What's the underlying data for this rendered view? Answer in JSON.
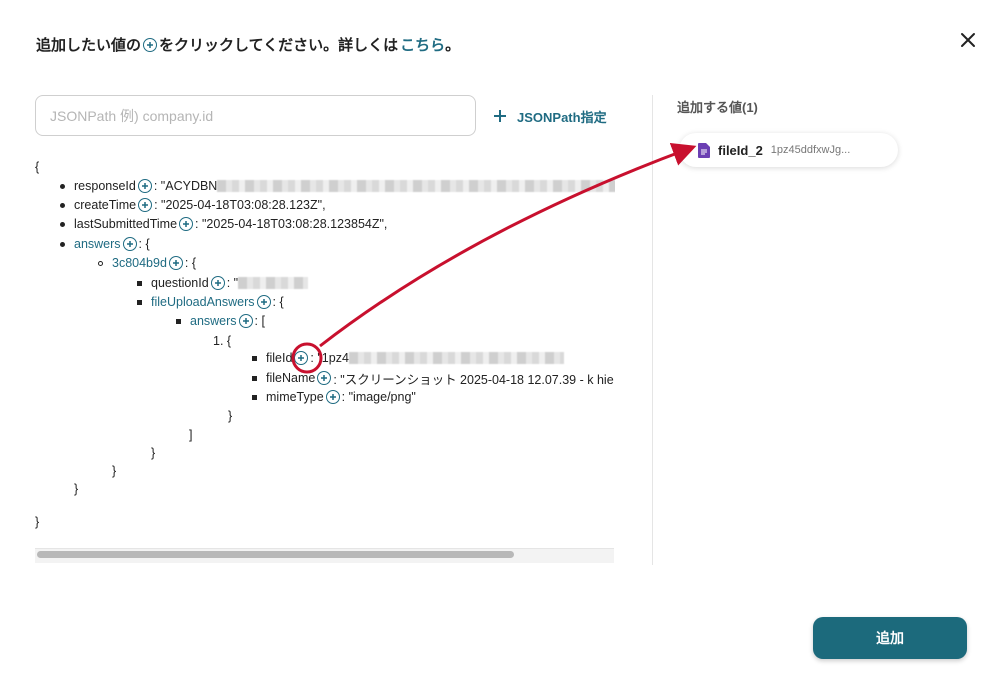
{
  "header": {
    "text_before": "追加したい値の",
    "text_after": "をクリックしてください。詳しくは",
    "link": "こちら",
    "end": "。"
  },
  "search": {
    "placeholder": "JSONPath 例) company.id",
    "value": ""
  },
  "jsonpath_button": {
    "label": "JSONPath指定"
  },
  "tree": {
    "open_brace": "{",
    "responseId": {
      "key": "responseId",
      "value": ": \"ACYDBN"
    },
    "createTime": {
      "key": "createTime",
      "value": ": \"2025-04-18T03:08:28.123Z\","
    },
    "lastSubmittedTime": {
      "key": "lastSubmittedTime",
      "value": ": \"2025-04-18T03:08:28.123854Z\","
    },
    "answers": {
      "key": "answers",
      "value": ": {"
    },
    "answerId": {
      "key": "3c804b9d",
      "value": ": {"
    },
    "questionId": {
      "key": "questionId",
      "value": ": \""
    },
    "fileUploadAnswers": {
      "key": "fileUploadAnswers",
      "value": ": {"
    },
    "answers_inner": {
      "key": "answers",
      "value": ": ["
    },
    "item_index": "1. {",
    "fileId": {
      "key": "fileId",
      "value": ": \"1pz4"
    },
    "fileName": {
      "key": "fileName",
      "value": ": \"スクリーンショット 2025-04-18 12.07.39 - k hie"
    },
    "mimeType": {
      "key": "mimeType",
      "value": ": \"image/png\""
    },
    "close_brace": "}",
    "close_bracket": "]"
  },
  "right_panel": {
    "title": "追加する値(1)",
    "chip": {
      "name": "fileId_2",
      "value": "1pz45ddfxwJg..."
    }
  },
  "add_button": {
    "label": "追加"
  },
  "colors": {
    "accent": "#1f6b82",
    "button": "#1c6a7c",
    "annotation": "#c8102e",
    "file_icon": "#6b3fb3"
  }
}
